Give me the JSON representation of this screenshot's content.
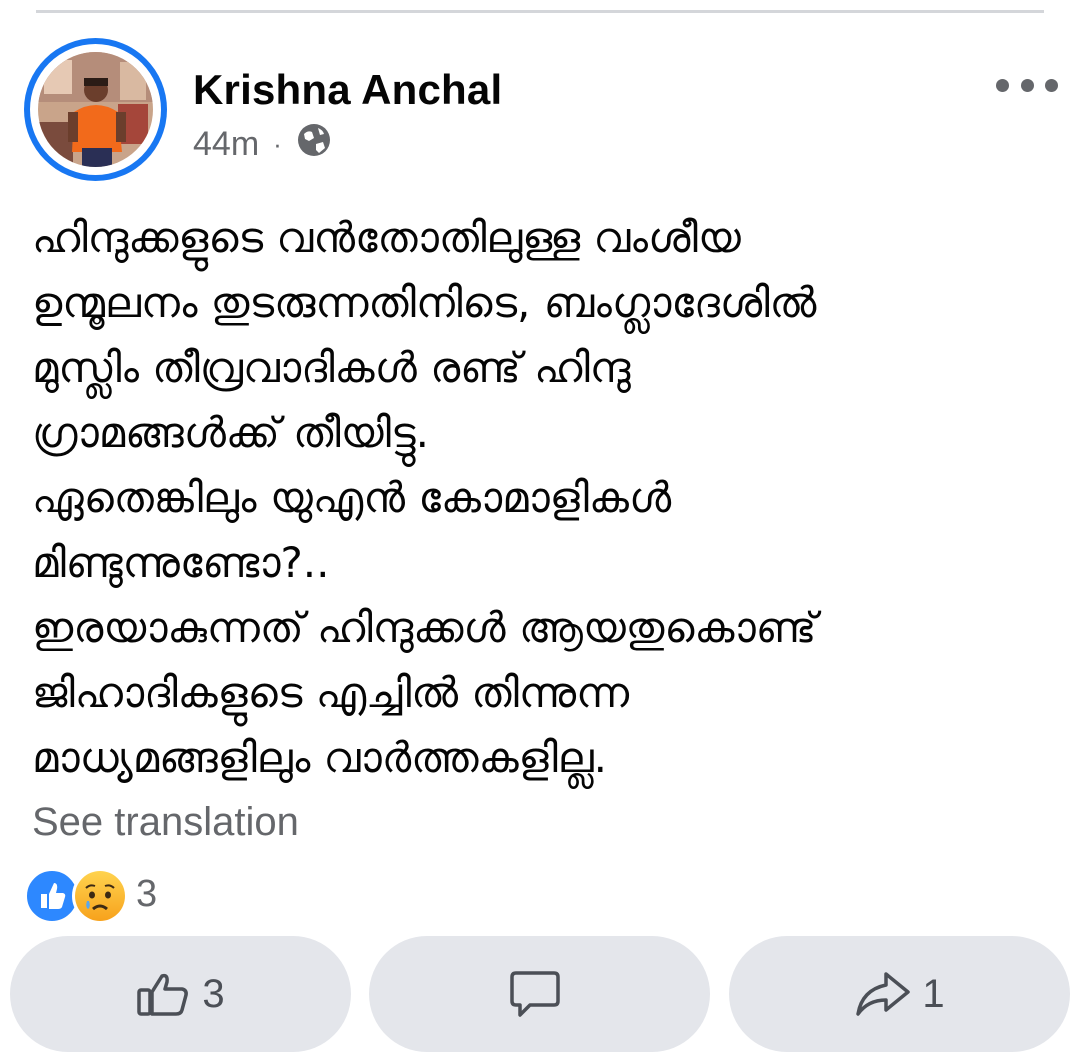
{
  "post": {
    "author_name": "Krishna Anchal",
    "timestamp": "44m",
    "separator": "·",
    "privacy_icon": "globe-icon",
    "more_icon": "more-dots-icon",
    "text_lines": [
      "ഹിന്ദുക്കളുടെ വൻതോതിലുള്ള വംശീയ",
      "ഉന്മൂലനം തുടരുന്നതിനിടെ, ബംഗ്ലാദേശിൽ",
      "മുസ്ലിം തീവ്രവാദികൾ രണ്ട് ഹിന്ദു",
      "ഗ്രാമങ്ങൾക്ക് തീയിട്ടു.",
      "ഏതെങ്കിലും യുഎൻ കോമാളികൾ",
      "മിണ്ടുന്നുണ്ടോ?..",
      "ഇരയാകുന്നത് ഹിന്ദുക്കൾ ആയതുകൊണ്ട്",
      "ജിഹാദികളുടെ എച്ചിൽ തിന്നുന്ന",
      "മാധ്യമങ്ങളിലും വാർത്തകളില്ല."
    ],
    "see_translation": "See translation"
  },
  "reactions": {
    "icons": [
      "like-reaction-icon",
      "sad-reaction-icon"
    ],
    "count": "3"
  },
  "actions": {
    "like_count": "3",
    "comment_count": "",
    "share_count": "1"
  },
  "colors": {
    "accent": "#1877f2",
    "like_blue": "#2d88ff",
    "button_bg": "#e4e6eb",
    "secondary_text": "#65676b"
  }
}
